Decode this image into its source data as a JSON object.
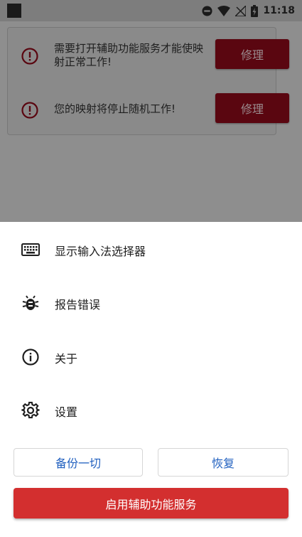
{
  "status_bar": {
    "time": "11:18",
    "icons": [
      "app-notification-icon",
      "do-not-disturb-icon",
      "wifi-icon",
      "no-signal-icon",
      "battery-charging-icon"
    ]
  },
  "warnings": [
    {
      "icon": "alert-circle-icon",
      "text": "需要打开辅助功能服务才能使映射正常工作!",
      "button": "修理"
    },
    {
      "icon": "alert-circle-icon",
      "text": "您的映射将停止随机工作!",
      "button": "修理"
    }
  ],
  "menu": {
    "items": [
      {
        "icon": "keyboard-icon",
        "label": "显示输入法选择器"
      },
      {
        "icon": "bug-icon",
        "label": "报告错误"
      },
      {
        "icon": "info-icon",
        "label": "关于"
      },
      {
        "icon": "gear-icon",
        "label": "设置"
      }
    ],
    "backup_label": "备份一切",
    "restore_label": "恢复",
    "enable_label": "启用辅助功能服务"
  },
  "colors": {
    "primary": "#d32f2f",
    "link": "#1f5fbf",
    "fix_button_dimmed": "#5a0610"
  }
}
